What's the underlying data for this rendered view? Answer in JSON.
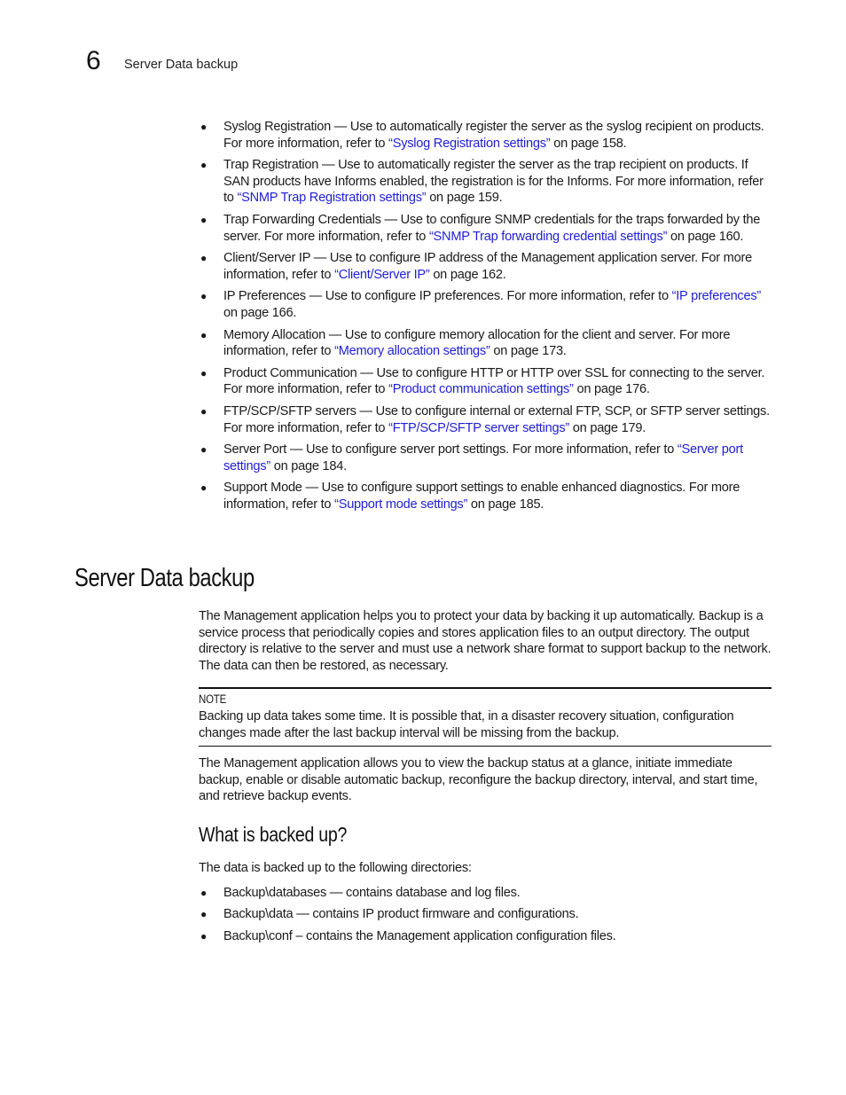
{
  "header": {
    "chapter_number": "6",
    "running_title": "Server Data backup"
  },
  "top_bullets": [
    {
      "pre": "Syslog Registration — Use to automatically register the server as the syslog recipient on products. For more information, refer to ",
      "link": "“Syslog Registration settings”",
      "post": " on page 158."
    },
    {
      "pre": "Trap Registration — Use to automatically register the server as the trap recipient on products. If SAN products have Informs enabled, the registration is for the Informs. For more information, refer to ",
      "link": "“SNMP Trap Registration settings”",
      "post": " on page 159."
    },
    {
      "pre": "Trap Forwarding Credentials — Use to configure SNMP credentials for the traps forwarded by the server. For more information, refer to ",
      "link": "“SNMP Trap forwarding credential settings”",
      "post": " on page 160."
    },
    {
      "pre": "Client/Server IP — Use to configure IP address of the Management application server. For more information, refer to ",
      "link": "“Client/Server IP”",
      "post": " on page 162."
    },
    {
      "pre": "IP Preferences — Use to configure IP preferences. For more information, refer to ",
      "link": "“IP preferences”",
      "post": " on page 166."
    },
    {
      "pre": "Memory Allocation — Use to configure memory allocation for the client and server. For more information, refer to ",
      "link": "“Memory allocation settings”",
      "post": " on page 173."
    },
    {
      "pre": "Product Communication — Use to configure HTTP or HTTP over SSL for connecting to the server. For more information, refer to ",
      "link": "“Product communication settings”",
      "post": " on page 176."
    },
    {
      "pre": "FTP/SCP/SFTP servers —  Use to configure internal or external FTP, SCP, or SFTP server settings. For more information, refer to ",
      "link": "“FTP/SCP/SFTP server settings”",
      "post": " on page 179."
    },
    {
      "pre": "Server Port — Use to configure server port settings. For more information, refer to ",
      "link": "“Server port settings”",
      "post": " on page 184."
    },
    {
      "pre": "Support Mode — Use to configure support settings to enable enhanced diagnostics. For more information, refer to ",
      "link": "“Support mode settings”",
      "post": " on page 185."
    }
  ],
  "section": {
    "title": "Server Data backup",
    "intro": "The Management application helps you to protect your data by backing it up automatically. Backup is a service process that periodically copies and stores application files to an output directory. The output directory is relative to the server and must use a network share format to support backup to the network. The data can then be restored, as necessary.",
    "note_label": "NOTE",
    "note_text": "Backing up data takes some time. It is possible that, in a disaster recovery situation, configuration changes made after the last backup interval will be missing from the backup.",
    "para2": "The Management application allows you to view the backup status at a glance, initiate immediate backup, enable or disable automatic backup, reconfigure the backup directory, interval, and start time, and retrieve backup events."
  },
  "subsection": {
    "title": "What is backed up?",
    "intro": "The data is backed up to the following directories:",
    "items": [
      "Backup\\databases — contains database and log files.",
      "Backup\\data — contains  IP product firmware and configurations.",
      "Backup\\conf – contains the Management application configuration files."
    ]
  },
  "colors": {
    "link": "#1f1fd6",
    "text": "#1a1a1a"
  }
}
